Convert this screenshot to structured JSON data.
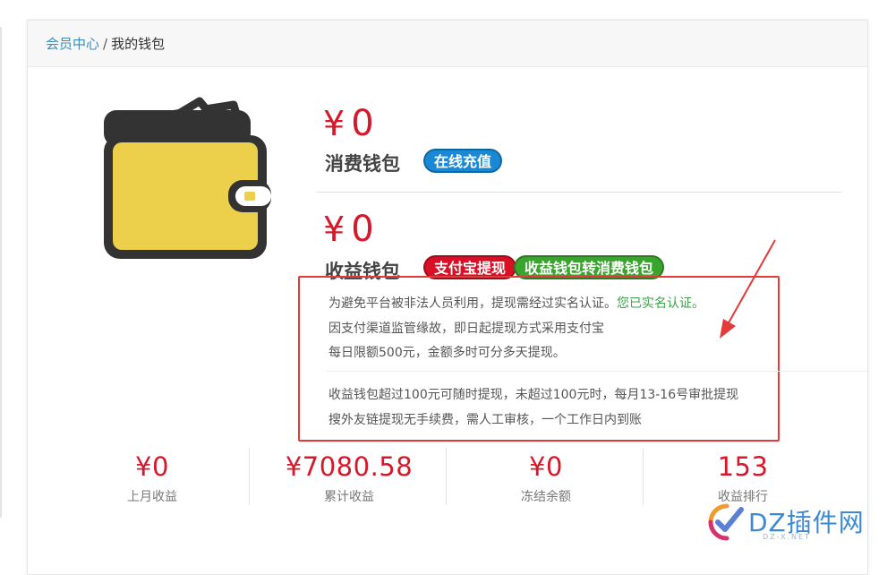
{
  "breadcrumb": {
    "link": "会员中心",
    "separator": "/",
    "current": "我的钱包"
  },
  "consume_wallet": {
    "currency": "¥",
    "amount": "0",
    "label": "消费钱包",
    "recharge_button": "在线充值"
  },
  "income_wallet": {
    "currency": "¥",
    "amount": "0",
    "label": "收益钱包",
    "alipay_button": "支付宝提现",
    "transfer_button": "收益钱包转消费钱包"
  },
  "notice": {
    "line1": "为避免平台被非法人员利用，提现需经过实名认证。",
    "line1_status": "您已实名认证。",
    "line2": "因支付渠道监管缘故，即日起提现方式采用支付宝",
    "line3": "每日限额500元，金额多时可分多天提现。",
    "line4": "收益钱包超过100元可随时提现，未超过100元时，每月13-16号审批提现",
    "line5": "搜外友链提现无手续费，需人工审核，一个工作日内到账"
  },
  "stats": [
    {
      "value": "¥0",
      "label": "上月收益"
    },
    {
      "value": "¥7080.58",
      "label": "累计收益"
    },
    {
      "value": "¥0",
      "label": "冻结余额"
    },
    {
      "value": "153",
      "label": "收益排行"
    }
  ],
  "watermark": {
    "brand": "DZ插件网",
    "sub": "DZ-X.NET"
  },
  "colors": {
    "amount_red": "#d6182b",
    "link_blue": "#3c8dbc",
    "annotation_red": "#e33a3a",
    "verified_green": "#3ca34a"
  }
}
